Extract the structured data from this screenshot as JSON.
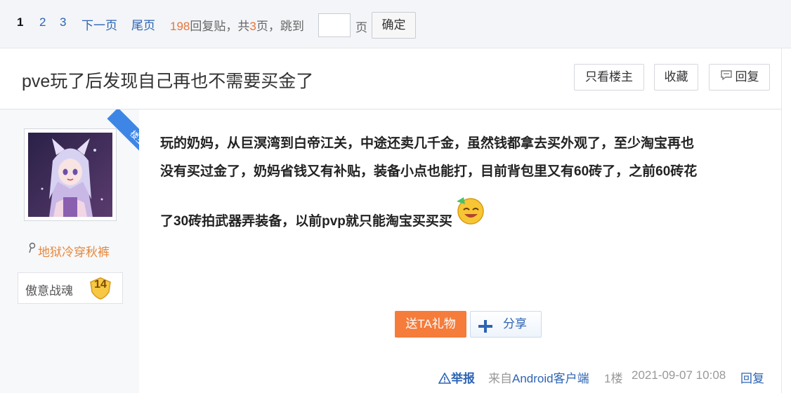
{
  "pager": {
    "pages": [
      "1",
      "2",
      "3"
    ],
    "next": "下一页",
    "last": "尾页",
    "reply_count": "198",
    "reply_label": "回复贴，共",
    "total_pages": "3",
    "pages_suffix": "页，",
    "jump_label": "跳到",
    "jump_value": "",
    "page_unit": "页",
    "confirm": "确定"
  },
  "thread": {
    "title": "pve玩了后发现自己再也不需要买金了",
    "only_op": "只看楼主",
    "favorite": "收藏",
    "reply": "回复"
  },
  "author": {
    "op_badge": "楼主",
    "name": "地狱冷穿秋裤",
    "level_name": "傲意战魂",
    "level": "14"
  },
  "post": {
    "lines": [
      "玩的奶妈，从巨溟湾到白帝江关，中途还卖几千金，虽然钱都拿去买外观了，至少淘宝再也",
      "没有买过金了，奶妈省钱又有补贴，装备小点也能打，目前背包里又有60砖了，之前60砖花",
      "了30砖拍武器弄装备，以前pvp就只能淘宝买买买"
    ],
    "gift_button": "送TA礼物",
    "share_button": "分享",
    "report": "举报",
    "source": "来自Android客户端",
    "floor": "1楼",
    "time": "2021-09-07 10:08",
    "reply": "回复"
  },
  "colors": {
    "link": "#2d64b3",
    "accent_orange": "#f57c3a",
    "username": "#e6873c",
    "op_ribbon": "#3d86e6"
  },
  "icons": [
    "reply-bubble-icon",
    "share-plus-icon",
    "warning-icon",
    "gender-icon",
    "level-shield-icon",
    "laughing-emoji-icon"
  ]
}
